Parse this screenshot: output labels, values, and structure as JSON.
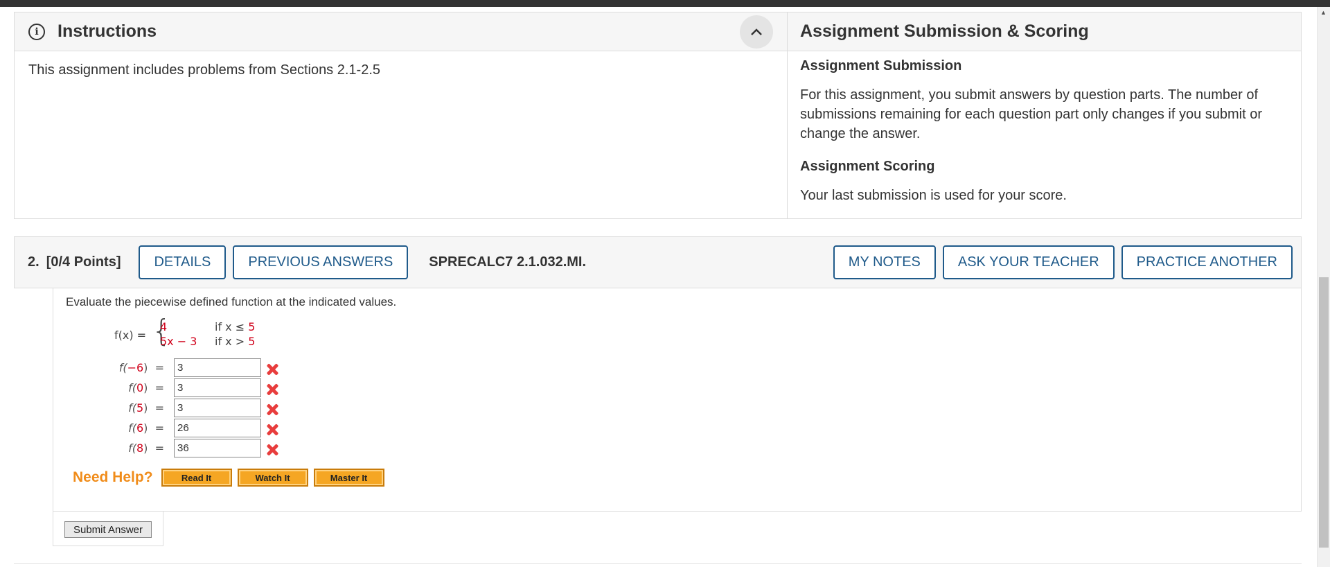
{
  "instructions": {
    "title": "Instructions",
    "body": "This assignment includes problems from Sections 2.1-2.5"
  },
  "submission": {
    "title": "Assignment Submission & Scoring",
    "submission_heading": "Assignment Submission",
    "submission_text": "For this assignment, you submit answers by question parts. The number of submissions remaining for each question part only changes if you submit or change the answer.",
    "scoring_heading": "Assignment Scoring",
    "scoring_text": "Your last submission is used for your score."
  },
  "question": {
    "number": "2.",
    "points": "[0/4 Points]",
    "details_label": "DETAILS",
    "previous_answers_label": "PREVIOUS ANSWERS",
    "code": "SPRECALC7 2.1.032.MI.",
    "my_notes_label": "MY NOTES",
    "ask_teacher_label": "ASK YOUR TEACHER",
    "practice_another_label": "PRACTICE ANOTHER",
    "prompt": "Evaluate the piecewise defined function at the indicated values.",
    "function": {
      "name": "f(x) =",
      "case1_expr": "4",
      "case1_cond_text": "if x ≤",
      "case1_cond_val": "5",
      "case2_expr_a": "5x",
      "case2_expr_b": "− 3",
      "case2_cond_text": "if x >",
      "case2_cond_val": "5"
    },
    "evaluations": [
      {
        "fn": "f(",
        "arg": "−6",
        "close": ")  =",
        "answer": "3",
        "status": "incorrect"
      },
      {
        "fn": "f(",
        "arg": "0",
        "close": ")  =",
        "answer": "3",
        "status": "incorrect"
      },
      {
        "fn": "f(",
        "arg": "5",
        "close": ")  =",
        "answer": "3",
        "status": "incorrect"
      },
      {
        "fn": "f(",
        "arg": "6",
        "close": ")  =",
        "answer": "26",
        "status": "incorrect"
      },
      {
        "fn": "f(",
        "arg": "8",
        "close": ")  =",
        "answer": "36",
        "status": "incorrect"
      }
    ],
    "need_help": "Need Help?",
    "help_buttons": [
      "Read It",
      "Watch It",
      "Master It"
    ],
    "submit_label": "Submit Answer"
  },
  "colors": {
    "accent": "#1f5a8a",
    "red_value": "#d0021b",
    "incorrect": "#e83d3d",
    "need_help": "#f08c1a"
  }
}
